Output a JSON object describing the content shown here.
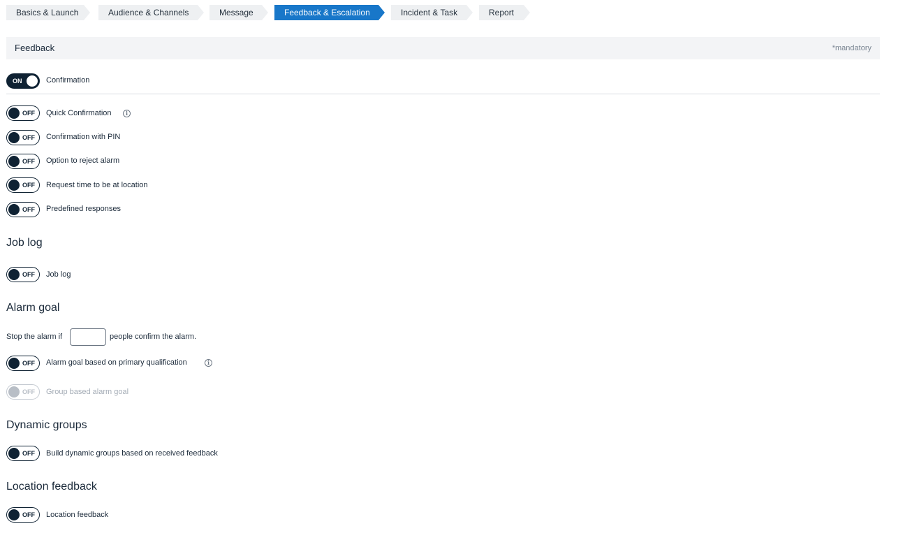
{
  "steps": [
    {
      "label": "Basics & Launch"
    },
    {
      "label": "Audience & Channels"
    },
    {
      "label": "Message"
    },
    {
      "label": "Feedback & Escalation",
      "active": true
    },
    {
      "label": "Incident & Task"
    },
    {
      "label": "Report"
    }
  ],
  "feedback": {
    "title": "Feedback",
    "mandatory": "*mandatory",
    "confirmation": {
      "state": "ON",
      "label": "Confirmation"
    },
    "options": [
      {
        "state": "OFF",
        "label": "Quick Confirmation",
        "info": true
      },
      {
        "state": "OFF",
        "label": "Confirmation with PIN"
      },
      {
        "state": "OFF",
        "label": "Option to reject alarm"
      },
      {
        "state": "OFF",
        "label": "Request time to be at location"
      },
      {
        "state": "OFF",
        "label": "Predefined responses"
      }
    ]
  },
  "job_log": {
    "heading": "Job log",
    "toggle": {
      "state": "OFF",
      "label": "Job log"
    }
  },
  "alarm_goal": {
    "heading": "Alarm goal",
    "stop_prefix": "Stop the alarm if",
    "stop_suffix": "people confirm the alarm.",
    "count_value": "",
    "primary_toggle": {
      "state": "OFF",
      "label": "Alarm goal based on primary qualification",
      "info": true
    },
    "group_toggle": {
      "state": "OFF",
      "label": "Group based alarm goal",
      "disabled": true
    }
  },
  "dynamic_groups": {
    "heading": "Dynamic groups",
    "toggle": {
      "state": "OFF",
      "label": "Build dynamic groups based on received feedback"
    }
  },
  "location_feedback": {
    "heading": "Location feedback",
    "toggle": {
      "state": "OFF",
      "label": "Location feedback"
    }
  },
  "colors": {
    "accent": "#1877c9",
    "toggle_dark": "#0f2233",
    "step_bg": "#eef0f2"
  },
  "icons": {
    "info": "info-circle-icon"
  }
}
